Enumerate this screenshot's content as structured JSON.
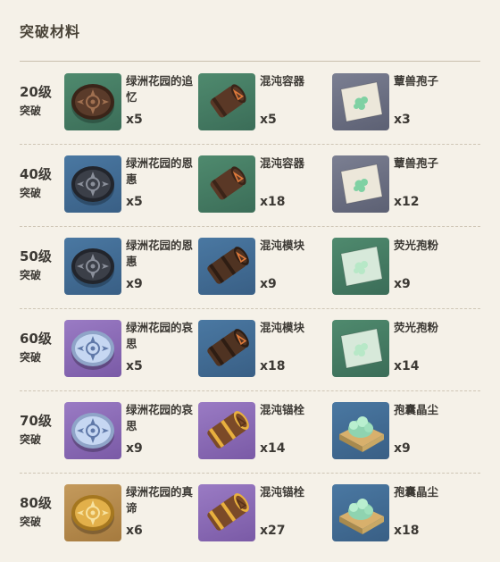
{
  "title": "突破材料",
  "colors": {
    "tier_gray": "#6b6f82",
    "tier_green": "#3f7a61",
    "tier_blue": "#3f6b95",
    "tier_purple": "#8a69b6",
    "tier_gold": "#b68849"
  },
  "rows": [
    {
      "level": "20级",
      "ascend": "突破",
      "items": [
        {
          "name": "绿洲花园的追忆",
          "qty": "x5",
          "icon": "medallion-bronze-icon",
          "tier": "green"
        },
        {
          "name": "混沌容器",
          "qty": "x5",
          "icon": "chaos-cylinder-icon",
          "tier": "green"
        },
        {
          "name": "蕈兽孢子",
          "qty": "x3",
          "icon": "spore-cloth-icon",
          "tier": "gray"
        }
      ]
    },
    {
      "level": "40级",
      "ascend": "突破",
      "items": [
        {
          "name": "绿洲花园的恩惠",
          "qty": "x5",
          "icon": "medallion-dark-icon",
          "tier": "blue"
        },
        {
          "name": "混沌容器",
          "qty": "x18",
          "icon": "chaos-cylinder-icon",
          "tier": "green"
        },
        {
          "name": "蕈兽孢子",
          "qty": "x12",
          "icon": "spore-cloth-icon",
          "tier": "gray"
        }
      ]
    },
    {
      "level": "50级",
      "ascend": "突破",
      "items": [
        {
          "name": "绿洲花园的恩惠",
          "qty": "x9",
          "icon": "medallion-dark-icon",
          "tier": "blue"
        },
        {
          "name": "混沌模块",
          "qty": "x9",
          "icon": "chaos-module-icon",
          "tier": "blue"
        },
        {
          "name": "荧光孢粉",
          "qty": "x9",
          "icon": "spore-powder-icon",
          "tier": "green"
        }
      ]
    },
    {
      "level": "60级",
      "ascend": "突破",
      "items": [
        {
          "name": "绿洲花园的哀思",
          "qty": "x5",
          "icon": "medallion-silver-icon",
          "tier": "purple"
        },
        {
          "name": "混沌模块",
          "qty": "x18",
          "icon": "chaos-module-icon",
          "tier": "blue"
        },
        {
          "name": "荧光孢粉",
          "qty": "x14",
          "icon": "spore-powder-icon",
          "tier": "green"
        }
      ]
    },
    {
      "level": "70级",
      "ascend": "突破",
      "items": [
        {
          "name": "绿洲花园的哀思",
          "qty": "x9",
          "icon": "medallion-silver-icon",
          "tier": "purple"
        },
        {
          "name": "混沌锚栓",
          "qty": "x14",
          "icon": "chaos-bolt-icon",
          "tier": "purple"
        },
        {
          "name": "孢囊晶尘",
          "qty": "x9",
          "icon": "spore-crystal-icon",
          "tier": "blue"
        }
      ]
    },
    {
      "level": "80级",
      "ascend": "突破",
      "items": [
        {
          "name": "绿洲花园的真谛",
          "qty": "x6",
          "icon": "medallion-gold-icon",
          "tier": "gold"
        },
        {
          "name": "混沌锚栓",
          "qty": "x27",
          "icon": "chaos-bolt-icon",
          "tier": "purple"
        },
        {
          "name": "孢囊晶尘",
          "qty": "x18",
          "icon": "spore-crystal-icon",
          "tier": "blue"
        }
      ]
    }
  ]
}
